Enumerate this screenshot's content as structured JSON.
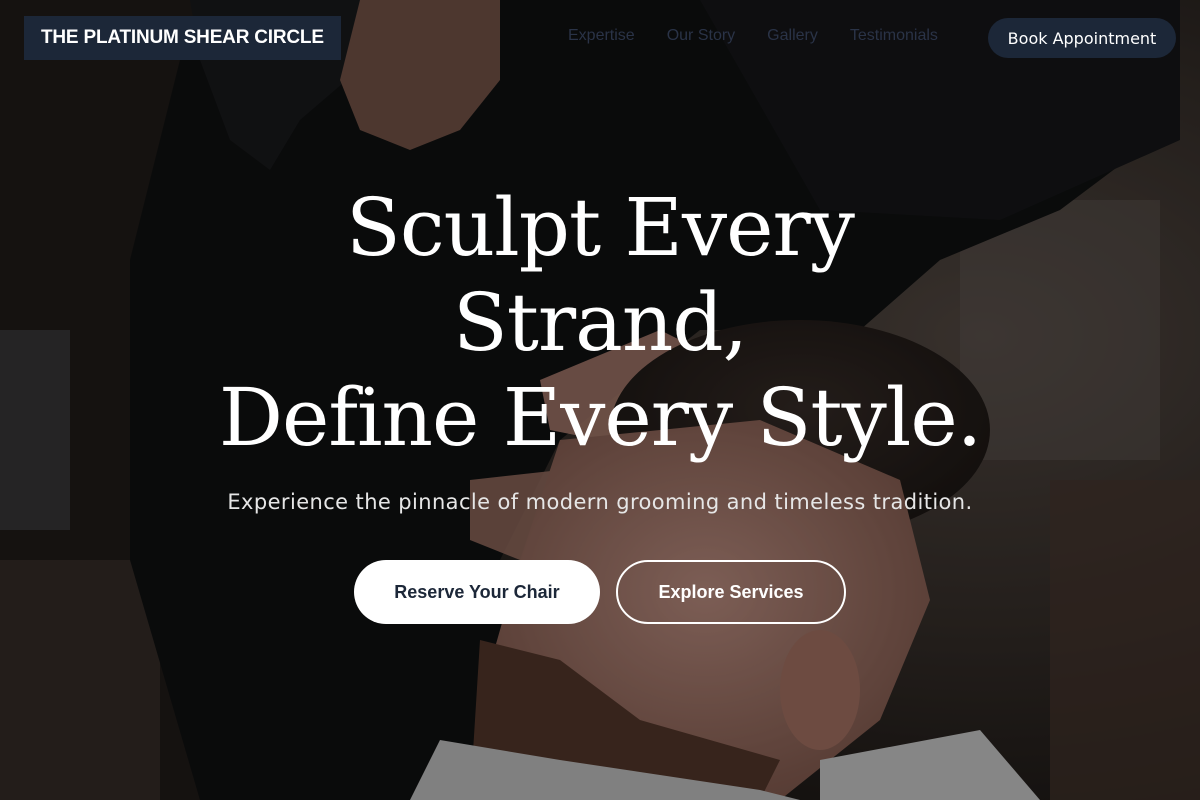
{
  "brand": {
    "name": "THE PLATINUM SHEAR CIRCLE"
  },
  "nav": {
    "links": [
      "Expertise",
      "Our Story",
      "Gallery",
      "Testimonials"
    ],
    "book_label": "Book Appointment"
  },
  "hero": {
    "headline_lines": [
      "Sculpt Every",
      "Strand,",
      "Define Every Style."
    ],
    "subtitle": "Experience the pinnacle of modern grooming and timeless tradition.",
    "primary_cta": "Reserve Your Chair",
    "secondary_cta": "Explore Services"
  },
  "colors": {
    "accent": "#1c2738",
    "text": "#ffffff"
  }
}
